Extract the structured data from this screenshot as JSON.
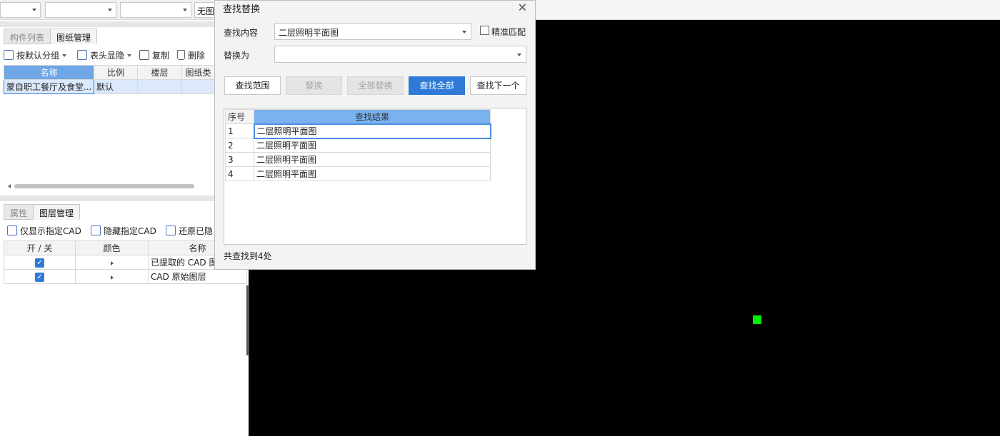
{
  "topbar": {
    "combo3_text": "无图"
  },
  "left": {
    "tabs_top": [
      "构件列表",
      "图纸管理"
    ],
    "toolbar_top": {
      "group_label": "按默认分组",
      "header_toggle_label": "表头显隐",
      "copy_label": "复制",
      "delete_label": "删除"
    },
    "drawing_table": {
      "headers": [
        "名称",
        "比例",
        "楼层",
        "图纸类"
      ],
      "rows": [
        [
          "蒙自职工餐厅及食堂...",
          "默认",
          "",
          ""
        ]
      ]
    },
    "tabs_bottom": [
      "属性",
      "图层管理"
    ],
    "toolbar_bottom": {
      "show_only_label": "仅显示指定CAD",
      "hide_label": "隐藏指定CAD",
      "restore_label": "还原已隐"
    },
    "layer_table": {
      "headers": [
        "开 / 关",
        "颜色",
        "名称"
      ],
      "rows": [
        {
          "checked": true,
          "name": "已提取的 CAD 图"
        },
        {
          "checked": true,
          "name": "CAD 原始图层"
        }
      ]
    }
  },
  "dialog": {
    "title": "查找替换",
    "find_label": "查找内容",
    "find_value": "二层照明平面图",
    "exact_match_label": "精准匹配",
    "exact_match_checked": false,
    "replace_label": "替换为",
    "replace_value": "",
    "buttons": {
      "scope": "查找范围",
      "replace": "替换",
      "replace_all": "全部替换",
      "find_all": "查找全部",
      "find_next": "查找下一个"
    },
    "results": {
      "headers": [
        "序号",
        "查找结果"
      ],
      "rows": [
        [
          "1",
          "二层照明平面图"
        ],
        [
          "2",
          "二层照明平面图"
        ],
        [
          "3",
          "二层照明平面图"
        ],
        [
          "4",
          "二层照明平面图"
        ]
      ]
    },
    "summary": "共查找到4处"
  },
  "colors": {
    "accent": "#2e7ad6",
    "canvas": "#000000",
    "marker": "#00ee00"
  }
}
